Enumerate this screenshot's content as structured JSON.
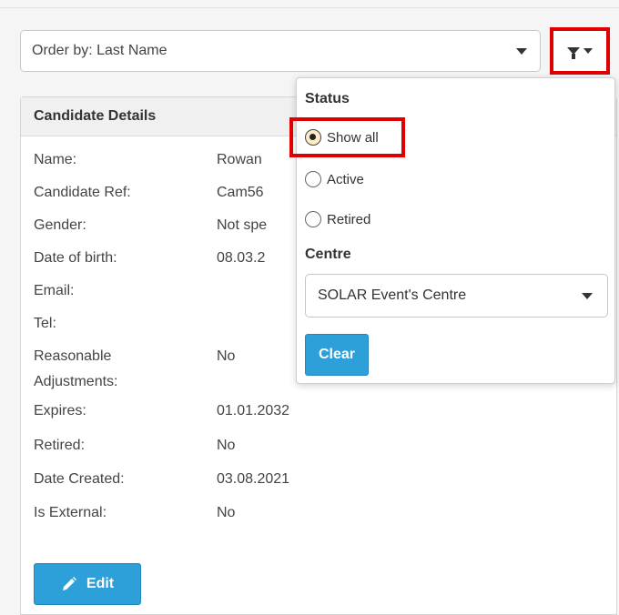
{
  "order_by": {
    "label": "Order by: Last Name"
  },
  "card": {
    "title": "Candidate Details",
    "rows": [
      {
        "key": "Name:",
        "value": "Rowan"
      },
      {
        "key": "Candidate Ref:",
        "value": "Cam56"
      },
      {
        "key": "Gender:",
        "value": "Not spe"
      },
      {
        "key": "Date of birth:",
        "value": "08.03.2"
      },
      {
        "key": "Email:",
        "value": ""
      },
      {
        "key": "Tel:",
        "value": ""
      },
      {
        "key": "Reasonable Adjustments:",
        "value": "No"
      },
      {
        "key": "Expires:",
        "value": "01.01.2032"
      },
      {
        "key": "Retired:",
        "value": "No"
      },
      {
        "key": "Date Created:",
        "value": "03.08.2021"
      },
      {
        "key": "Is External:",
        "value": "No"
      }
    ],
    "edit_label": "Edit"
  },
  "filter": {
    "status_title": "Status",
    "status_options": [
      {
        "label": "Show all",
        "checked": true
      },
      {
        "label": "Active",
        "checked": false
      },
      {
        "label": "Retired",
        "checked": false
      }
    ],
    "centre_title": "Centre",
    "centre_selected": "SOLAR Event's Centre",
    "clear_label": "Clear"
  },
  "colors": {
    "accent": "#2d9fd9",
    "highlight": "#e00000"
  },
  "icons": {
    "filter": "funnel-icon",
    "caret": "chevron-down-icon",
    "edit": "pencil-icon"
  }
}
